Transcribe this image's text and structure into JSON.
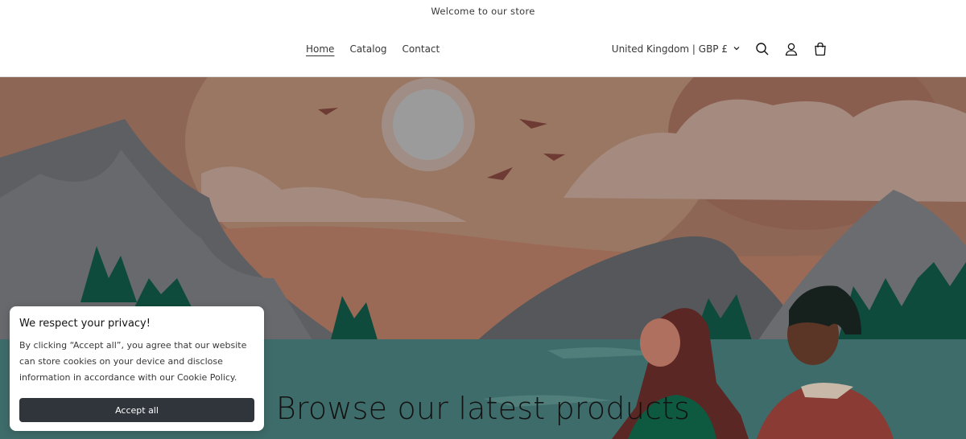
{
  "announcement": {
    "text": "Welcome to our store"
  },
  "header": {
    "nav": [
      {
        "label": "Home",
        "active": true
      },
      {
        "label": "Catalog",
        "active": false
      },
      {
        "label": "Contact",
        "active": false
      }
    ],
    "country_selector": "United Kingdom | GBP £",
    "icons": [
      "search-icon",
      "account-icon",
      "cart-icon",
      "chevron-down-icon"
    ]
  },
  "hero": {
    "heading": "Browse our latest products"
  },
  "cookie_banner": {
    "title": "We respect your privacy!",
    "text": "By clicking “Accept all”, you agree that our website can store cookies on your device and disclose information in accordance with our Cookie Policy.",
    "button": "Accept all"
  },
  "colors": {
    "sky": "#8e6656",
    "water": "#3e6c6a",
    "forest": "#0f4b3c",
    "button": "#30343b"
  }
}
